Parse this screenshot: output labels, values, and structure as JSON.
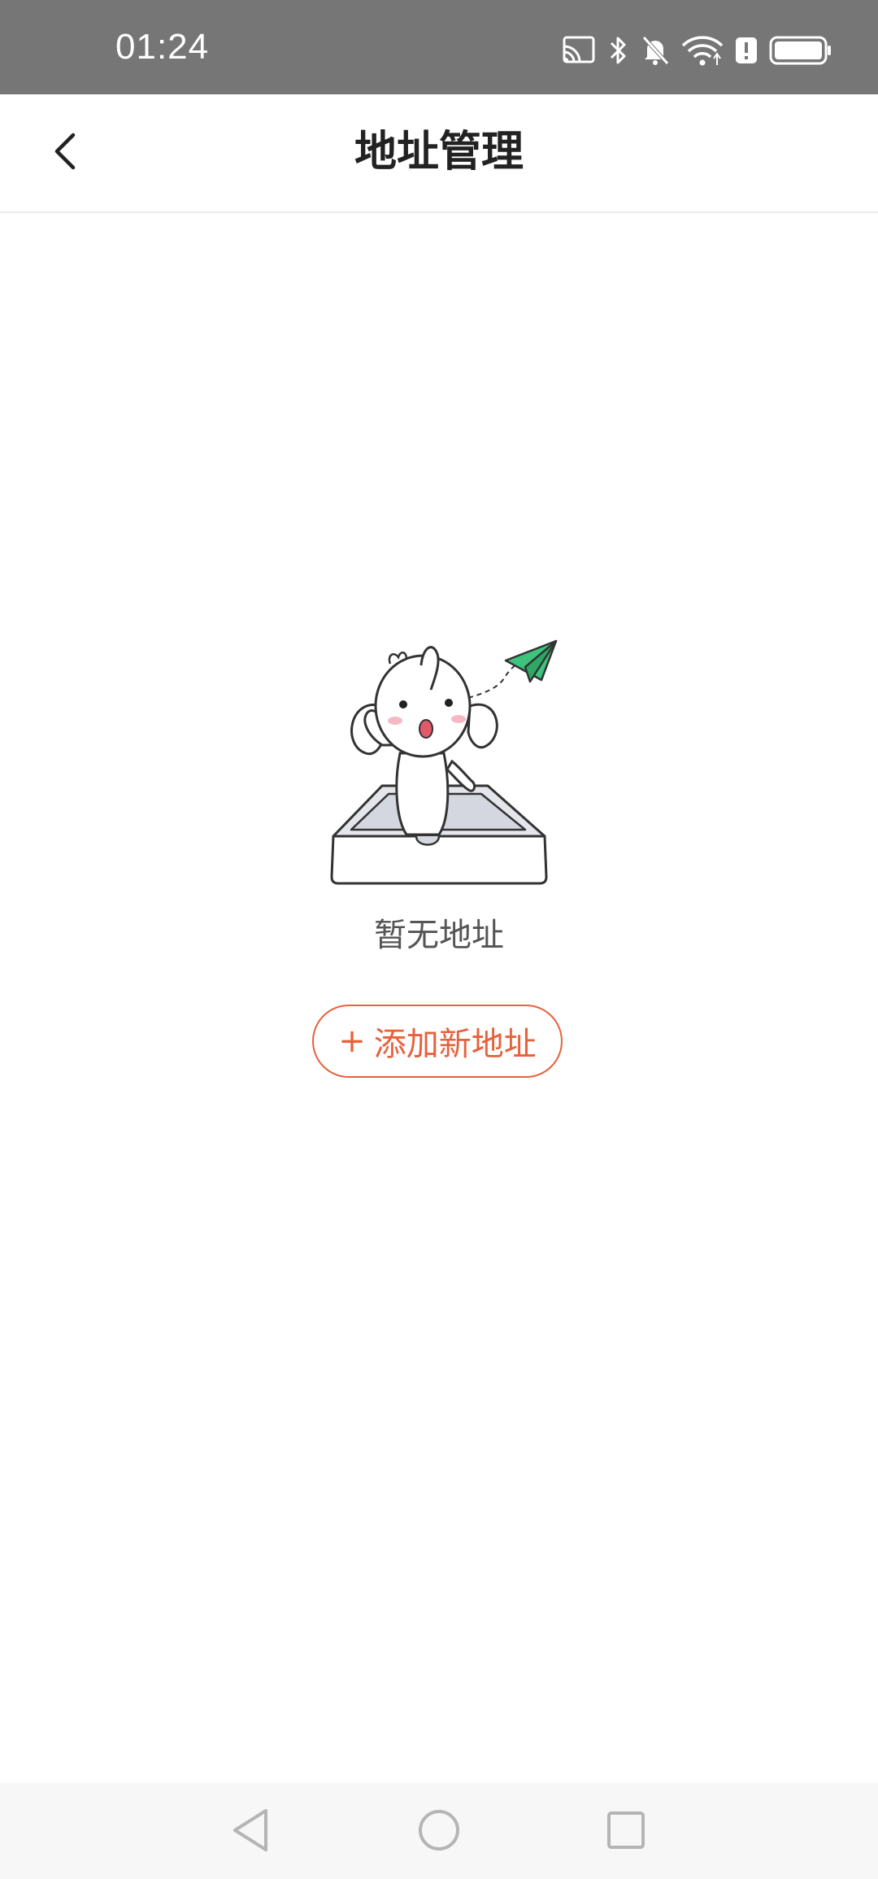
{
  "status_bar": {
    "time": "01:24",
    "icons": [
      "cast-icon",
      "bluetooth-icon",
      "bell-off-icon",
      "wifi-icon",
      "alert-icon",
      "battery-icon"
    ]
  },
  "header": {
    "title": "地址管理",
    "back_icon": "chevron-left-icon"
  },
  "empty_state": {
    "message": "暂无地址",
    "illustration": "elephant-in-box-paper-plane"
  },
  "add_button": {
    "plus": "+",
    "label": "添加新地址"
  },
  "colors": {
    "status_bar_bg": "#767676",
    "accent": "#e8613c",
    "plane": "#3cc47c"
  },
  "system_nav": {
    "icons": [
      "back-triangle-icon",
      "home-circle-icon",
      "recents-square-icon"
    ]
  }
}
